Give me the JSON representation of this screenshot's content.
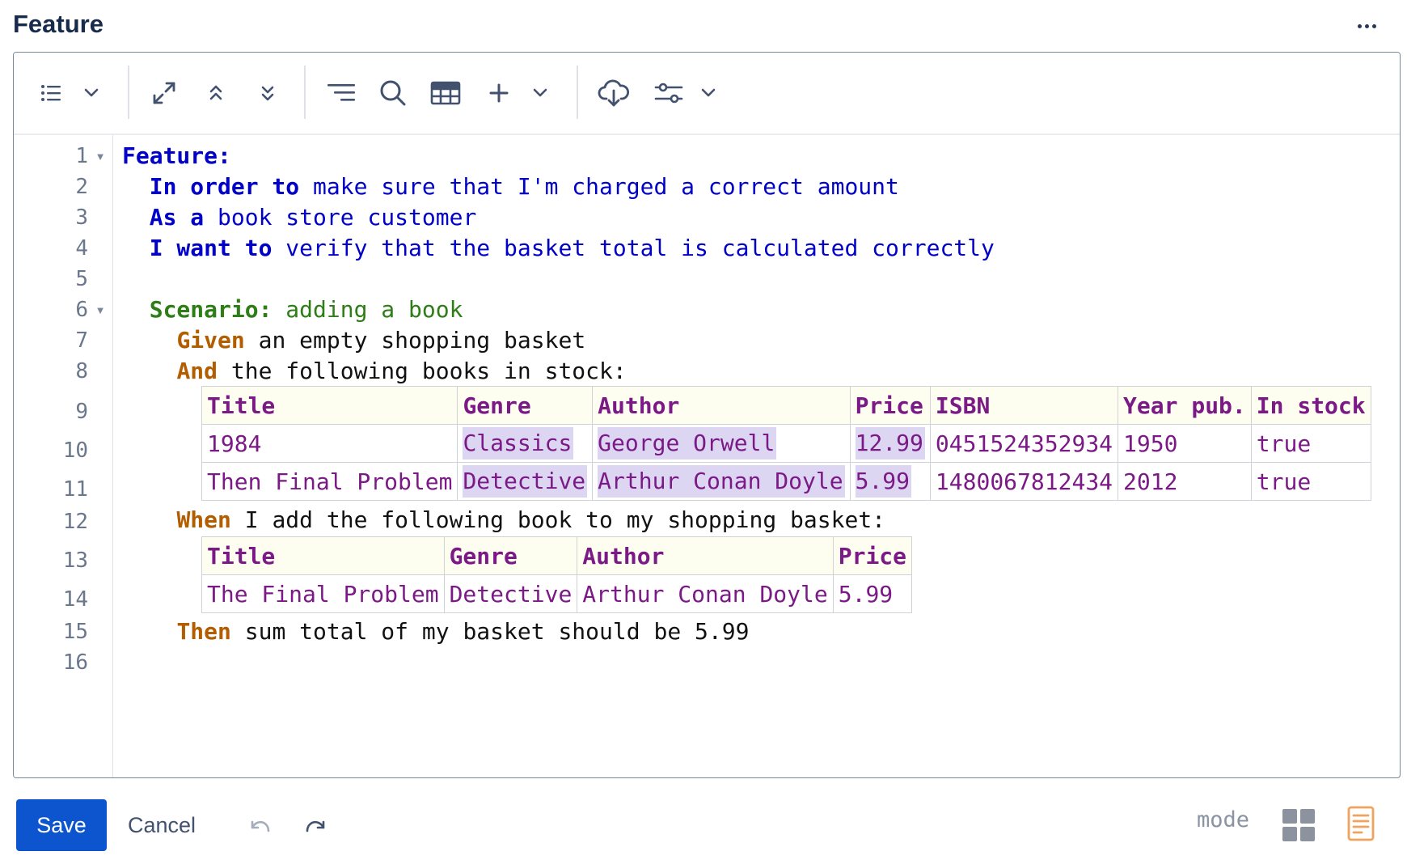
{
  "header": {
    "title": "Feature"
  },
  "toolbar": {
    "buttons": [
      {
        "name": "list-format",
        "icon": "list-icon"
      },
      {
        "name": "list-format-dropdown",
        "icon": "chevron-down-icon"
      },
      {
        "name": "expand",
        "icon": "expand-icon"
      },
      {
        "name": "collapse-up",
        "icon": "chevrons-up-icon"
      },
      {
        "name": "collapse-down",
        "icon": "chevrons-down-icon"
      },
      {
        "name": "indent-format",
        "icon": "align-right-lines-icon"
      },
      {
        "name": "search",
        "icon": "search-icon"
      },
      {
        "name": "insert-table",
        "icon": "table-icon"
      },
      {
        "name": "add",
        "icon": "plus-icon"
      },
      {
        "name": "add-dropdown",
        "icon": "chevron-down-icon"
      },
      {
        "name": "cloud-download",
        "icon": "cloud-download-icon"
      },
      {
        "name": "settings",
        "icon": "sliders-icon"
      },
      {
        "name": "settings-dropdown",
        "icon": "chevron-down-icon"
      }
    ]
  },
  "editor": {
    "line_numbers": [
      "1",
      "2",
      "3",
      "4",
      "5",
      "6",
      "7",
      "8",
      "9",
      "10",
      "11",
      "12",
      "13",
      "14",
      "15",
      "16"
    ],
    "lines": {
      "l1_kw": "Feature:",
      "l2_kw": "In order to",
      "l2_txt": " make sure that I'm charged a correct amount",
      "l3_kw": "As a",
      "l3_txt": " book store customer",
      "l4_kw": "I want to",
      "l4_txt": " verify that the basket total is calculated correctly",
      "l6_kw": "Scenario:",
      "l6_txt": " adding a book",
      "l7_kw": "Given",
      "l7_txt": " an empty shopping basket",
      "l8_kw": "And",
      "l8_txt": " the following books in stock:",
      "l12_kw": "When",
      "l12_txt": " I add the following book to my shopping basket:",
      "l15_kw": "Then",
      "l15_txt": " sum total of my basket should be 5.99"
    },
    "stock_table": {
      "headers": [
        "Title",
        "Genre",
        "Author",
        "Price",
        "ISBN",
        "Year pub.",
        "In stock"
      ],
      "rows": [
        [
          "1984",
          "Classics",
          "George Orwell",
          "12.99",
          "0451524352934",
          "1950",
          "true"
        ],
        [
          "Then Final Problem",
          "Detective",
          "Arthur Conan Doyle",
          "5.99",
          "1480067812434",
          "2012",
          "true"
        ]
      ]
    },
    "basket_table": {
      "headers": [
        "Title",
        "Genre",
        "Author",
        "Price"
      ],
      "rows": [
        [
          "The Final Problem",
          "Detective",
          "Arthur Conan Doyle",
          "5.99"
        ]
      ]
    }
  },
  "footer": {
    "save_label": "Save",
    "cancel_label": "Cancel",
    "mode_label": "mode"
  },
  "colors": {
    "save_button": "#0c55cf",
    "keyword_blue": "#0000c8",
    "keyword_green": "#2e7d17",
    "keyword_orange": "#b25d00",
    "table_text": "#7b1a86",
    "table_header_bg": "#fdfdf0",
    "cell_highlight": "#dcd6f2",
    "doc_icon": "#f0a35e"
  }
}
